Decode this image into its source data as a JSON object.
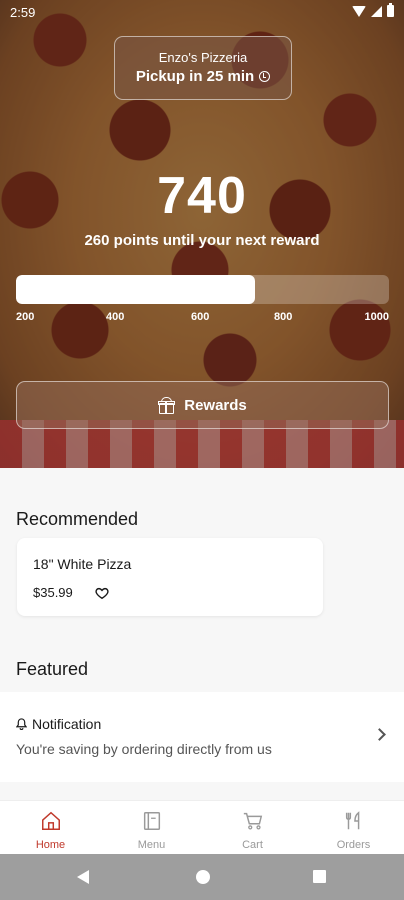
{
  "status_bar": {
    "time": "2:59"
  },
  "store": {
    "name": "Enzo's Pizzeria",
    "pickup": "Pickup in 25 min"
  },
  "points": {
    "value": "740",
    "subtitle": "260 points until your next reward",
    "progress_fraction": 0.64,
    "ticks": [
      "200",
      "400",
      "600",
      "800",
      "1000"
    ]
  },
  "rewards_button": {
    "label": "Rewards"
  },
  "recommended": {
    "title": "Recommended",
    "items": [
      {
        "name": "18\" White Pizza",
        "price": "$35.99"
      }
    ]
  },
  "featured": {
    "title": "Featured",
    "notification_title": "Notification",
    "notification_text": "You're saving by ordering directly from us"
  },
  "bottom_nav": {
    "items": [
      {
        "label": "Home",
        "icon": "home-icon",
        "active": true
      },
      {
        "label": "Menu",
        "icon": "menu-book-icon",
        "active": false
      },
      {
        "label": "Cart",
        "icon": "cart-icon",
        "active": false
      },
      {
        "label": "Orders",
        "icon": "fork-knife-icon",
        "active": false
      }
    ]
  },
  "colors": {
    "accent": "#c0392b",
    "nav_inactive": "#9a9a9a",
    "system_nav": "#9e9e9e"
  }
}
